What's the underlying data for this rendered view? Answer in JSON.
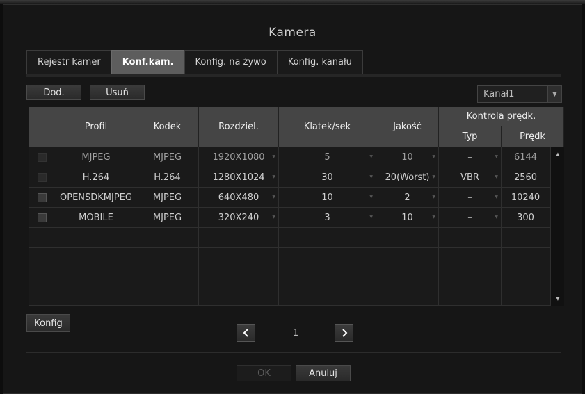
{
  "dialog": {
    "title": "Kamera"
  },
  "tabs": [
    {
      "label": "Rejestr kamer",
      "active": false
    },
    {
      "label": "Konf.kam.",
      "active": true
    },
    {
      "label": "Konfig. na żywo",
      "active": false
    },
    {
      "label": "Konfig. kanału",
      "active": false
    }
  ],
  "toolbar": {
    "add_label": "Dod.",
    "delete_label": "Usuń"
  },
  "channel_select": {
    "value": "Kanał1"
  },
  "table": {
    "headers": {
      "profile": "Profil",
      "codec": "Kodek",
      "resolution": "Rozdziel.",
      "fps": "Klatek/sek",
      "quality": "Jakość",
      "bitrate_control": "Kontrola prędk.",
      "type": "Typ",
      "bitrate": "Prędk"
    },
    "rows": [
      {
        "profile": "MJPEG",
        "codec": "MJPEG",
        "resolution": "1920X1080",
        "fps": "5",
        "quality": "10",
        "type": "–",
        "bitrate": "6144",
        "checkbox_enabled": false
      },
      {
        "profile": "H.264",
        "codec": "H.264",
        "resolution": "1280X1024",
        "fps": "30",
        "quality": "20(Worst)",
        "type": "VBR",
        "bitrate": "2560",
        "checkbox_enabled": false
      },
      {
        "profile": "OPENSDKMJPEG",
        "codec": "MJPEG",
        "resolution": "640X480",
        "fps": "10",
        "quality": "2",
        "type": "–",
        "bitrate": "10240",
        "checkbox_enabled": true
      },
      {
        "profile": "MOBILE",
        "codec": "MJPEG",
        "resolution": "320X240",
        "fps": "3",
        "quality": "10",
        "type": "–",
        "bitrate": "300",
        "checkbox_enabled": true
      }
    ],
    "empty_rows": 4
  },
  "config_button": {
    "label": "Konfig"
  },
  "pager": {
    "page": "1"
  },
  "footer": {
    "ok_label": "OK",
    "cancel_label": "Anuluj"
  }
}
